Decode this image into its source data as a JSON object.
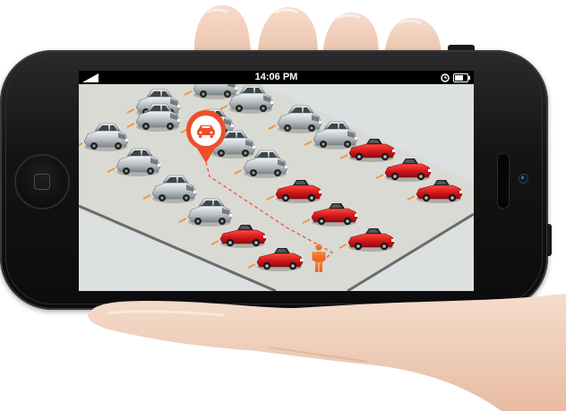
{
  "statusbar": {
    "time": "14:06 PM",
    "signal_icon": "signal-icon",
    "alarm_icon": "alarm-icon",
    "battery_icon": "battery-icon"
  },
  "map": {
    "destination_pin_icon": "car-location-pin-icon",
    "user_icon": "person-icon",
    "colors": {
      "pin": "#ee4f2a",
      "route": "#ee4f2a",
      "person": "#ef6a24",
      "red_car": "#d0171b",
      "silver_car": "#b9bfc3",
      "ground": "#d9dad4",
      "background": "#dde0e0"
    },
    "cars": [
      {
        "color": "silver"
      },
      {
        "color": "silver"
      },
      {
        "color": "silver"
      },
      {
        "color": "silver"
      },
      {
        "color": "silver"
      },
      {
        "color": "silver"
      },
      {
        "color": "silver"
      },
      {
        "color": "silver"
      },
      {
        "color": "silver"
      },
      {
        "color": "silver"
      },
      {
        "color": "silver"
      },
      {
        "color": "silver"
      },
      {
        "color": "silver"
      },
      {
        "color": "red"
      },
      {
        "color": "red"
      },
      {
        "color": "red"
      },
      {
        "color": "red"
      },
      {
        "color": "red"
      },
      {
        "color": "red"
      },
      {
        "color": "red"
      },
      {
        "color": "red"
      }
    ]
  }
}
